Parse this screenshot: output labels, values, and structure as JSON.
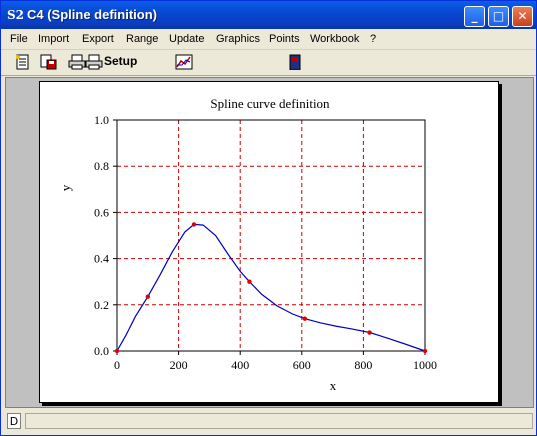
{
  "window": {
    "title": "C4 (Spline definition)",
    "app_icon": "S2",
    "controls": {
      "minimize": "minimize-icon",
      "maximize": "maximize-icon",
      "close": "close-icon"
    }
  },
  "menu": [
    "File",
    "Import",
    "Export",
    "Range",
    "Update",
    "Graphics",
    "Points",
    "Workbook",
    "?"
  ],
  "toolbar": {
    "setup_label": "Setup",
    "icons": [
      "new-sheet-icon",
      "save-icon",
      "print-icon",
      "print-setup-icon",
      "chart-icon",
      "book-icon"
    ]
  },
  "status": {
    "mode": "D"
  },
  "colors": {
    "title_bar": "#0a4fd8",
    "curve": "#0000c0",
    "points": "#e00000",
    "grid": "#cc0000"
  },
  "chart_data": {
    "type": "line",
    "title": "Spline curve definition",
    "xlabel": "x",
    "ylabel": "y",
    "xlim": [
      0,
      1000
    ],
    "ylim": [
      0,
      1
    ],
    "xticks": [
      0,
      200,
      400,
      600,
      800,
      1000
    ],
    "yticks": [
      0.0,
      0.2,
      0.4,
      0.6,
      0.8,
      1.0
    ],
    "xtick_labels": [
      "0",
      "200",
      "400",
      "600",
      "800",
      "1000"
    ],
    "ytick_labels": [
      "0.0",
      "0.2",
      "0.4",
      "0.6",
      "0.8",
      "1.0"
    ],
    "grid": true,
    "grid_style": "dashed",
    "series": [
      {
        "style": "curve",
        "x": [
          0,
          30,
          60,
          100,
          140,
          180,
          220,
          250,
          280,
          320,
          360,
          400,
          430,
          470,
          520,
          570,
          610,
          660,
          710,
          760,
          820,
          880,
          940,
          1000
        ],
        "y": [
          0.0,
          0.07,
          0.15,
          0.235,
          0.33,
          0.43,
          0.515,
          0.548,
          0.545,
          0.5,
          0.42,
          0.345,
          0.3,
          0.245,
          0.195,
          0.16,
          0.14,
          0.122,
          0.108,
          0.096,
          0.08,
          0.055,
          0.028,
          0.0
        ]
      },
      {
        "style": "points",
        "x": [
          0,
          100,
          250,
          430,
          610,
          820,
          1000
        ],
        "y": [
          0.0,
          0.235,
          0.548,
          0.3,
          0.14,
          0.08,
          0.0
        ]
      }
    ]
  }
}
